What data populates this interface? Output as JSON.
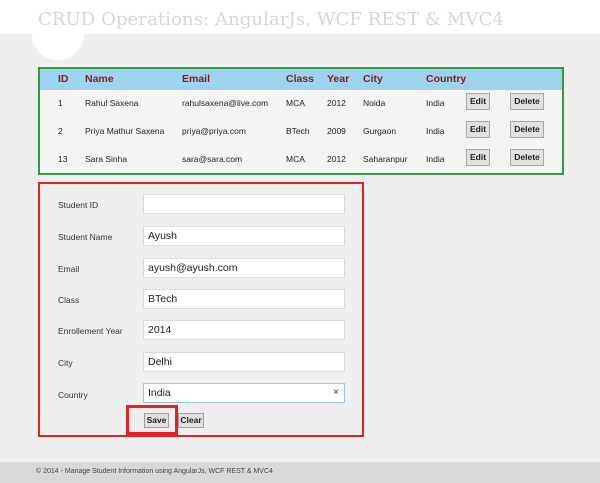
{
  "header": {
    "title": "CRUD Operations: AngularJs, WCF REST & MVC4"
  },
  "grid": {
    "columns": [
      "ID",
      "Name",
      "Email",
      "Class",
      "Year",
      "City",
      "Country"
    ],
    "rows": [
      {
        "id": "1",
        "name": "Rahul Saxena",
        "email": "rahulsaxena@live.com",
        "class": "MCA",
        "year": "2012",
        "city": "Noida",
        "country": "India"
      },
      {
        "id": "2",
        "name": "Priya Mathur Saxena",
        "email": "priya@priya.com",
        "class": "BTech",
        "year": "2009",
        "city": "Gurgaon",
        "country": "India"
      },
      {
        "id": "13",
        "name": "Sara Sinha",
        "email": "sara@sara.com",
        "class": "MCA",
        "year": "2012",
        "city": "Saharanpur",
        "country": "India"
      }
    ],
    "edit_label": "Edit",
    "delete_label": "Delete"
  },
  "form": {
    "fields": [
      {
        "label": "Student ID",
        "value": ""
      },
      {
        "label": "Student Name",
        "value": "Ayush"
      },
      {
        "label": "Email",
        "value": "ayush@ayush.com"
      },
      {
        "label": "Class",
        "value": "BTech"
      },
      {
        "label": "Enrollement Year",
        "value": "2014"
      },
      {
        "label": "City",
        "value": "Delhi"
      },
      {
        "label": "Country",
        "value": "India"
      }
    ],
    "clear_glyph": "×",
    "save_label": "Save",
    "clear_label": "Clear"
  },
  "footer": {
    "text": "© 2014 - Manage Student Information using AngularJs, WCF REST & MVC4"
  },
  "colors": {
    "grid_border": "#2e9d3e",
    "grid_header": "#9dd3ee",
    "header_text": "#8a1a1a",
    "form_border": "#e52222"
  }
}
